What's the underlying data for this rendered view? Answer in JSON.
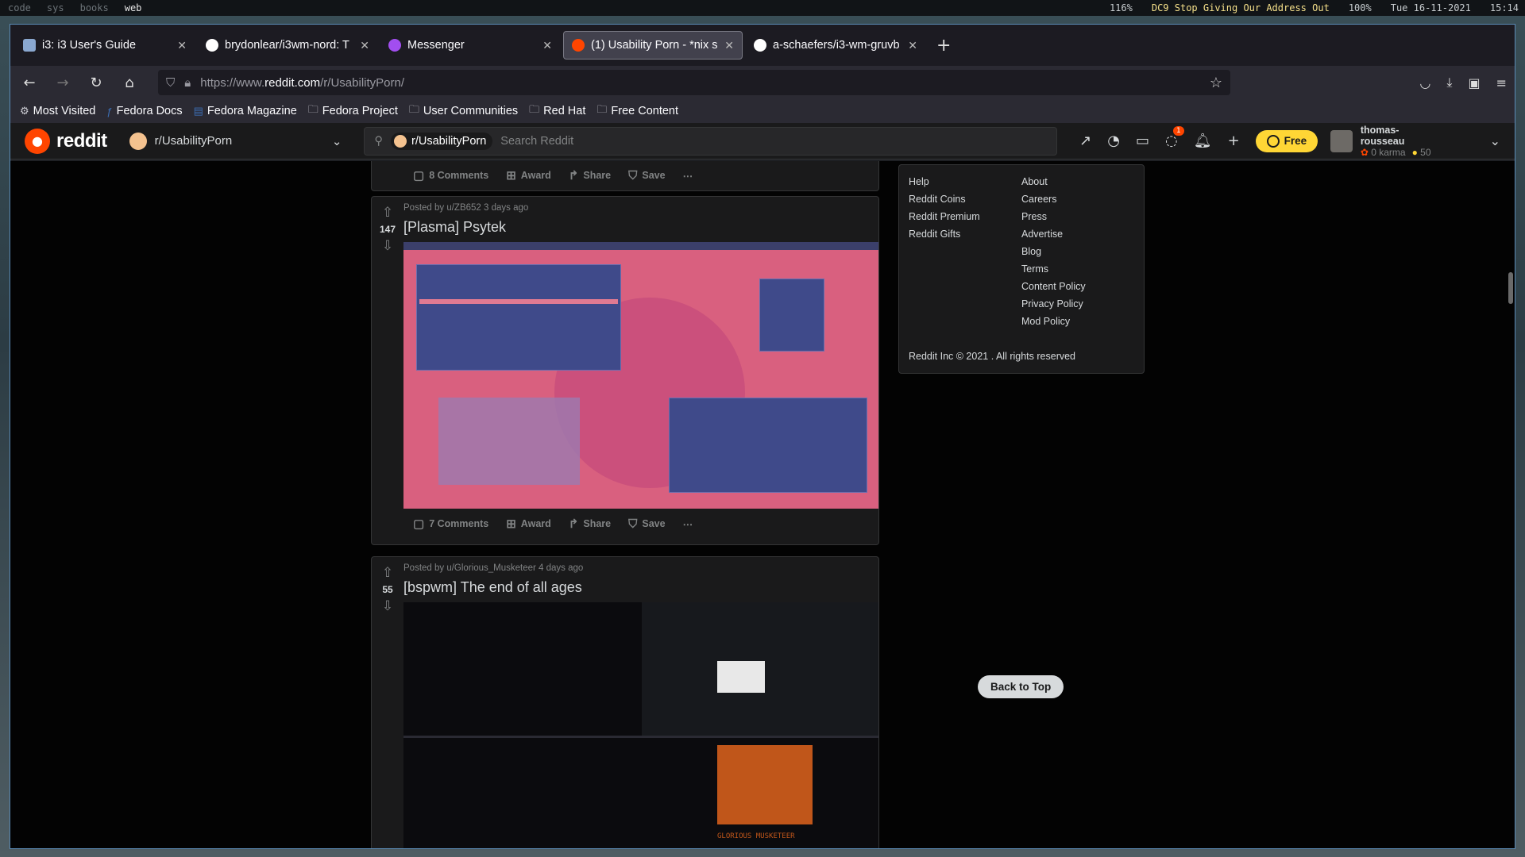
{
  "i3bar": {
    "workspaces": [
      "code",
      "sys",
      "books",
      "web"
    ],
    "status": {
      "volume": "116%",
      "message": "DC9 Stop Giving Our Address Out",
      "battery": "100%",
      "date": "Tue 16-11-2021",
      "time": "15:14"
    }
  },
  "browser": {
    "tabs": [
      {
        "title": "i3: i3 User's Guide"
      },
      {
        "title": "brydonlear/i3wm-nord: T"
      },
      {
        "title": "Messenger"
      },
      {
        "title": "(1) Usability Porn - *nix s"
      },
      {
        "title": "a-schaefers/i3-wm-gruvb"
      }
    ],
    "url_prefix": "https://www.",
    "url_host": "reddit.com",
    "url_path": "/r/UsabilityPorn/",
    "bookmarks": [
      "Most Visited",
      "Fedora Docs",
      "Fedora Magazine",
      "Fedora Project",
      "User Communities",
      "Red Hat",
      "Free Content"
    ]
  },
  "reddit": {
    "logo_text": "reddit",
    "subreddit": "r/UsabilityPorn",
    "search_chip": "r/UsabilityPorn",
    "search_placeholder": "Search Reddit",
    "chat_badge": "1",
    "free_label": "Free",
    "user": {
      "name": "thomas-rousseau",
      "karma": "0 karma",
      "coins": "50"
    }
  },
  "posts": [
    {
      "actions": {
        "comments": "8 Comments",
        "award": "Award",
        "share": "Share",
        "save": "Save"
      }
    },
    {
      "votes": "147",
      "posted": "Posted by u/ZB652 3 days ago",
      "title": "[Plasma] Psytek",
      "actions": {
        "comments": "7 Comments",
        "award": "Award",
        "share": "Share",
        "save": "Save"
      }
    },
    {
      "votes": "55",
      "posted": "Posted by u/Glorious_Musketeer 4 days ago",
      "title": "[bspwm] The end of all ages",
      "image_caption": "GLORIOUS MUSKETEER"
    }
  ],
  "footer": {
    "col1": [
      "Help",
      "Reddit Coins",
      "Reddit Premium",
      "Reddit Gifts"
    ],
    "col2": [
      "About",
      "Careers",
      "Press",
      "Advertise",
      "Blog",
      "Terms",
      "Content Policy",
      "Privacy Policy",
      "Mod Policy"
    ],
    "copyright": "Reddit Inc © 2021 . All rights reserved"
  },
  "back_to_top": "Back to Top"
}
